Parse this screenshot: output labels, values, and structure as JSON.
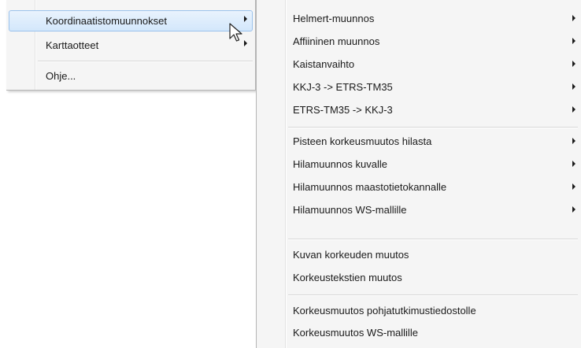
{
  "main_menu": {
    "items": [
      {
        "label": "Koordinaatistomuunnokset",
        "has_submenu": true,
        "highlighted": true
      },
      {
        "label": "Karttaotteet",
        "has_submenu": true,
        "highlighted": false
      },
      {
        "label": "Ohje...",
        "has_submenu": false,
        "highlighted": false
      }
    ]
  },
  "submenu": {
    "items": [
      {
        "label": "Helmert-muunnos",
        "has_submenu": true
      },
      {
        "label": "Affiininen muunnos",
        "has_submenu": true
      },
      {
        "label": "Kaistanvaihto",
        "has_submenu": true
      },
      {
        "label": "KKJ-3 -> ETRS-TM35",
        "has_submenu": true
      },
      {
        "label": "ETRS-TM35 -> KKJ-3",
        "has_submenu": true
      },
      {
        "label": "Pisteen korkeusmuutos hilasta",
        "has_submenu": true
      },
      {
        "label": "Hilamuunnos kuvalle",
        "has_submenu": true
      },
      {
        "label": "Hilamuunnos maastotietokannalle",
        "has_submenu": true
      },
      {
        "label": "Hilamuunnos WS-mallille",
        "has_submenu": true
      },
      {
        "label": "Kuvan korkeuden muutos",
        "has_submenu": false
      },
      {
        "label": "Korkeustekstien muutos",
        "has_submenu": false
      },
      {
        "label": "Korkeusmuutos pohjatutkimustiedostolle",
        "has_submenu": false
      },
      {
        "label": "Korkeusmuutos WS-mallille",
        "has_submenu": false
      }
    ]
  },
  "icons": {
    "submenu_arrow": "chevron-right-icon",
    "cursor": "mouse-pointer-icon"
  },
  "colors": {
    "menu_background": "#f5f5f5",
    "highlight_fill": "#d3e7fb",
    "highlight_border": "#9cc3ec",
    "text": "#1a1a1a"
  }
}
